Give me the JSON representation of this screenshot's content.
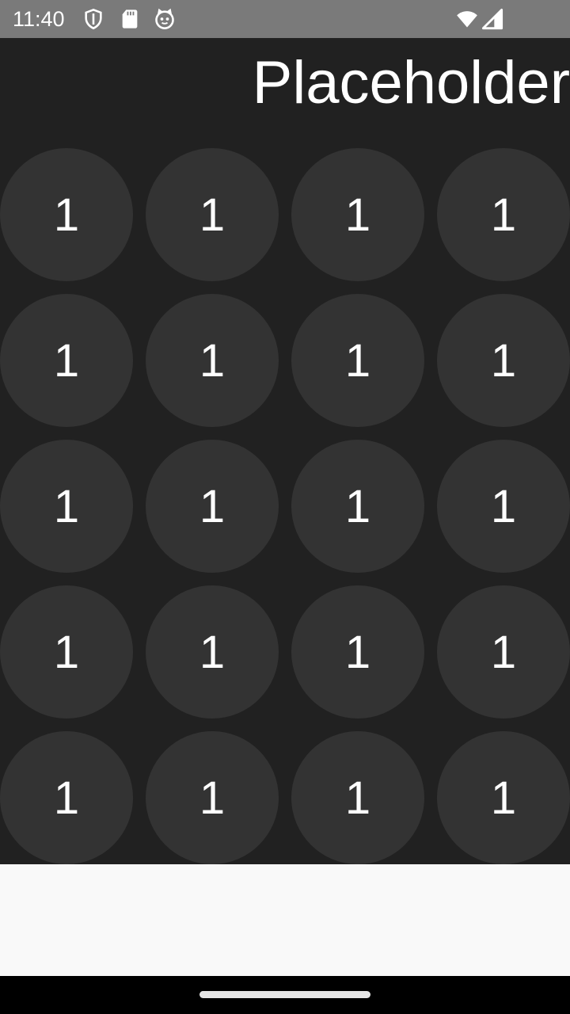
{
  "status_bar": {
    "time": "11:40",
    "left_icons": [
      "shield-icon",
      "sd-card-icon",
      "cat-icon"
    ],
    "right_icons": [
      "wifi-icon",
      "signal-icon"
    ]
  },
  "display": {
    "text": "Placeholder"
  },
  "keypad": {
    "rows": [
      [
        "1",
        "1",
        "1",
        "1"
      ],
      [
        "1",
        "1",
        "1",
        "1"
      ],
      [
        "1",
        "1",
        "1",
        "1"
      ],
      [
        "1",
        "1",
        "1",
        "1"
      ],
      [
        "1",
        "1",
        "1",
        "1"
      ]
    ]
  },
  "colors": {
    "background": "#212121",
    "key": "#333333",
    "status_bar": "#7a7a7a",
    "bottom_panel": "#f9f9f9"
  }
}
